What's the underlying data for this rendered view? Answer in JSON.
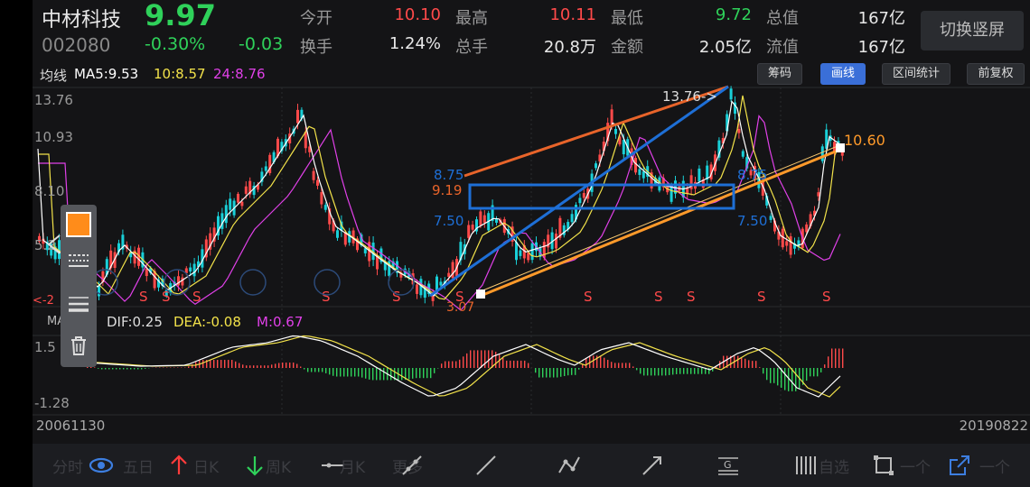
{
  "header": {
    "name": "中材科技",
    "code": "002080",
    "price": "9.97",
    "change_pct": "-0.30%",
    "change_abs": "-0.03",
    "quotes": [
      {
        "label": "今开",
        "value": "10.10",
        "color": "#ff4a4a"
      },
      {
        "label": "最高",
        "value": "10.11",
        "color": "#ff4a4a"
      },
      {
        "label": "最低",
        "value": "9.72",
        "color": "#2fd15a"
      },
      {
        "label": "总值",
        "value": "167亿",
        "color": "#e8e8e8"
      },
      {
        "label": "换手",
        "value": "1.24%",
        "color": "#e8e8e8"
      },
      {
        "label": "总手",
        "value": "20.8万",
        "color": "#e8e8e8"
      },
      {
        "label": "金额",
        "value": "2.05亿",
        "color": "#e8e8e8"
      },
      {
        "label": "流值",
        "value": "167亿",
        "color": "#e8e8e8"
      }
    ],
    "switch_label": "切换竖屏"
  },
  "ma": {
    "title": "均线",
    "ma5": "MA5:9.53",
    "ma10": "10:8.57",
    "ma24": "24:8.76"
  },
  "tools": {
    "chip": "筹码",
    "draw": "画线",
    "interval": "区间统计",
    "restore": "前复权"
  },
  "kline": {
    "y_ticks": [
      "13.76",
      "10.93",
      "8.10",
      "5.2"
    ],
    "annotations": {
      "high": "13.76->",
      "p875a": "8.75",
      "p919": "9.19",
      "p750a": "7.50",
      "p875b": "8.75",
      "p750b": "7.50",
      "p1060": "10.60",
      "low": "3.07",
      "left_low": "<-2"
    },
    "s_marks": [
      "S",
      "S",
      "S",
      "S",
      "S",
      "S",
      "S",
      "S",
      "S",
      "S",
      "S"
    ]
  },
  "macd": {
    "label": "MACD",
    "dif": "DIF:0.25",
    "dea": "DEA:-0.08",
    "m": "M:0.67",
    "y_top": "1.5",
    "y_bottom": "-1.28"
  },
  "dates": {
    "start": "20061130",
    "end": "20190822"
  },
  "bottom_bar": {
    "labels": [
      "分时",
      "五日",
      "日K",
      "周K",
      "月K",
      "更多",
      "自选",
      "一个",
      "一个"
    ]
  },
  "colors": {
    "up": "#ff4a4a",
    "down": "#2fd15a",
    "down_candle": "#19d0d8",
    "ma5": "#ffffff",
    "ma10": "#f2e24a",
    "ma24": "#e040e8",
    "accent": "#ff8c1a",
    "trend_blue": "#1e6fd6"
  }
}
